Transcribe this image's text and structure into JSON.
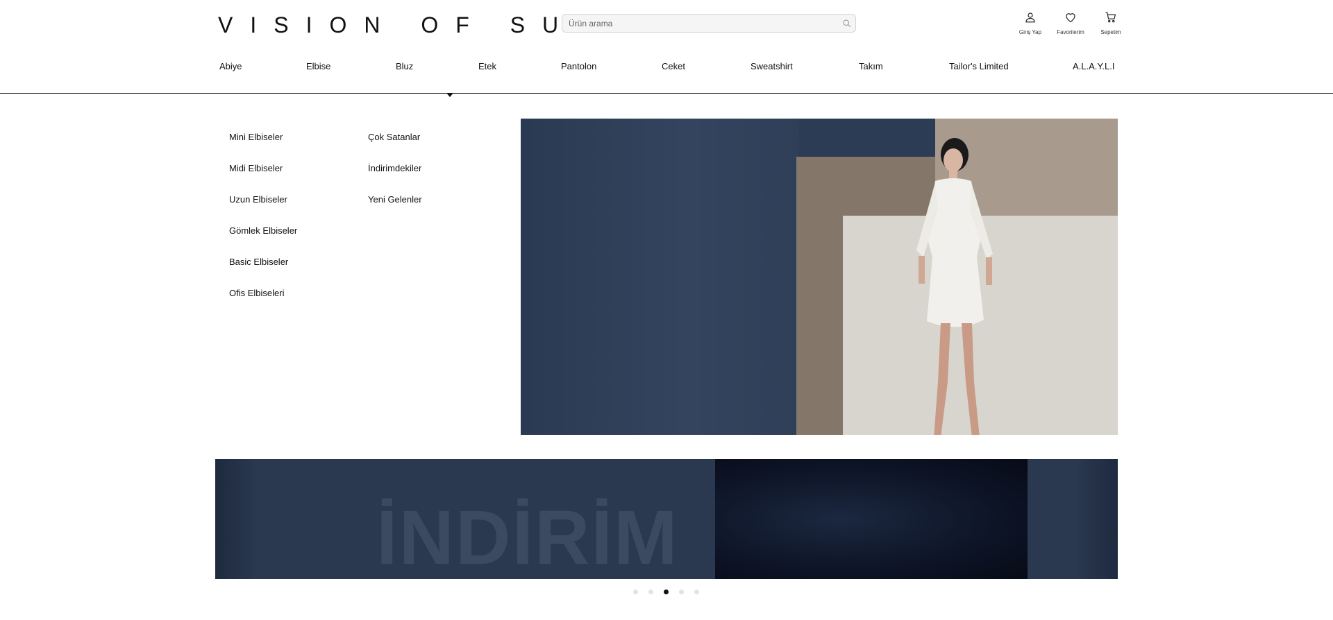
{
  "brand": {
    "logo": "VISION OF SULZ"
  },
  "search": {
    "placeholder": "Ürün arama"
  },
  "header_actions": [
    {
      "label": "Giriş Yap",
      "icon": "user-icon"
    },
    {
      "label": "Favorilerim",
      "icon": "heart-icon"
    },
    {
      "label": "Sepetim",
      "icon": "cart-icon"
    }
  ],
  "nav": [
    {
      "label": "Abiye"
    },
    {
      "label": "Elbise"
    },
    {
      "label": "Bluz"
    },
    {
      "label": "Etek"
    },
    {
      "label": "Pantolon"
    },
    {
      "label": "Ceket"
    },
    {
      "label": "Sweatshirt"
    },
    {
      "label": "Takım"
    },
    {
      "label": "Tailor's Limited"
    },
    {
      "label": "A.L.A.Y.L.I"
    }
  ],
  "mega_menu": {
    "col1": [
      {
        "label": "Mini Elbiseler"
      },
      {
        "label": "Midi Elbiseler"
      },
      {
        "label": "Uzun Elbiseler"
      },
      {
        "label": "Gömlek Elbiseler"
      },
      {
        "label": "Basic Elbiseler"
      },
      {
        "label": "Ofis Elbiseleri"
      }
    ],
    "col2": [
      {
        "label": "Çok Satanlar"
      },
      {
        "label": "İndirimdekiler"
      },
      {
        "label": "Yeni Gelenler"
      }
    ]
  },
  "banner": {
    "text": "İNDİRİM"
  },
  "carousel": {
    "slide_count": 5,
    "active_index": 2
  }
}
